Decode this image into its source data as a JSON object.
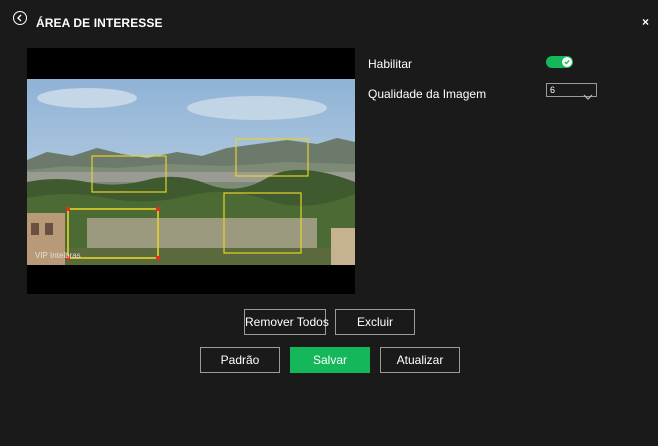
{
  "header": {
    "title": "ÁREA DE INTERESSE",
    "back_icon": "back-circle-icon",
    "close_label": "×"
  },
  "video": {
    "watermark": "VIP Intelbras",
    "roi_count": 4
  },
  "settings": {
    "enable_label": "Habilitar",
    "enable_state": true,
    "quality_label": "Qualidade da Imagem",
    "quality_value": "6"
  },
  "actions": {
    "remove_all_label": "Remover Todos",
    "delete_label": "Excluir",
    "default_label": "Padrão",
    "save_label": "Salvar",
    "refresh_label": "Atualizar"
  },
  "colors": {
    "accent": "#14b85a",
    "roi": "#e6d22a",
    "selected_roi_handle": "#e03020"
  }
}
